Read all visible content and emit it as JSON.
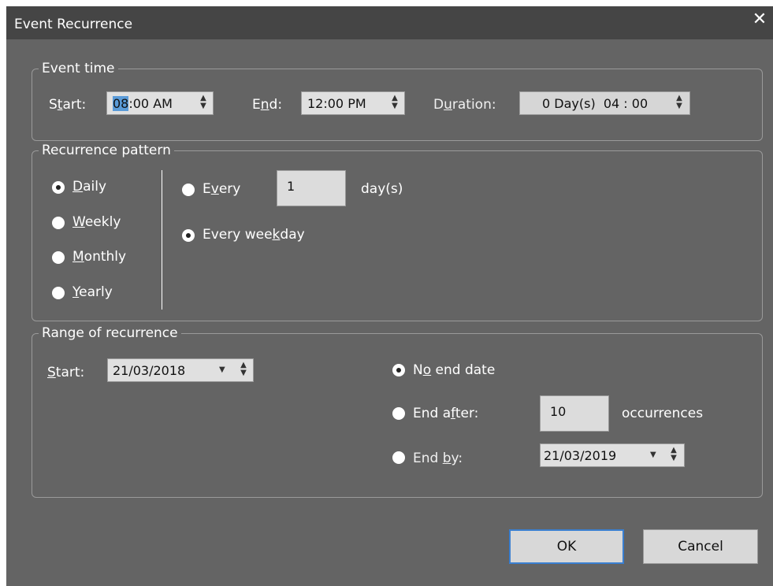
{
  "window": {
    "title": "Event Recurrence",
    "close_glyph": "✕"
  },
  "event_time": {
    "legend": "Event time",
    "start": {
      "label_pre": "S",
      "label_u": "t",
      "label_post": "art:",
      "value_hl": "08",
      "value_rest": ":00 AM"
    },
    "end": {
      "label_pre": "E",
      "label_u": "n",
      "label_post": "d:",
      "value": "12:00 PM"
    },
    "duration": {
      "label_pre": "D",
      "label_u": "u",
      "label_post": "ration:",
      "value": "0 Day(s)  04 : 00"
    }
  },
  "recurrence_pattern": {
    "legend": "Recurrence pattern",
    "frequency": [
      {
        "u": "D",
        "rest": "aily",
        "selected": true
      },
      {
        "u": "W",
        "rest": "eekly",
        "selected": false
      },
      {
        "u": "M",
        "rest": "onthly",
        "selected": false
      },
      {
        "u": "Y",
        "rest": "early",
        "selected": false
      }
    ],
    "every": {
      "pre": "E",
      "u": "v",
      "post": "ery",
      "value": "1",
      "unit": "day(s)",
      "selected": false
    },
    "every_weekday": {
      "pre": "Every wee",
      "u": "k",
      "post": "day",
      "selected": true
    }
  },
  "range": {
    "legend": "Range of recurrence",
    "start": {
      "u": "S",
      "rest": "tart:",
      "value": "21/03/2018"
    },
    "no_end": {
      "pre": "N",
      "u": "o",
      "post": " end date",
      "selected": true
    },
    "end_after": {
      "pre": "End a",
      "u": "f",
      "post": "ter:",
      "value": "10",
      "unit": "occurrences",
      "selected": false
    },
    "end_by": {
      "pre": "End ",
      "u": "b",
      "post": "y:",
      "value": "21/03/2019",
      "selected": false
    }
  },
  "buttons": {
    "ok": "OK",
    "cancel": "Cancel"
  },
  "icons": {
    "spin": "spin-arrows-icon",
    "dropdown": "dropdown-caret-icon"
  }
}
